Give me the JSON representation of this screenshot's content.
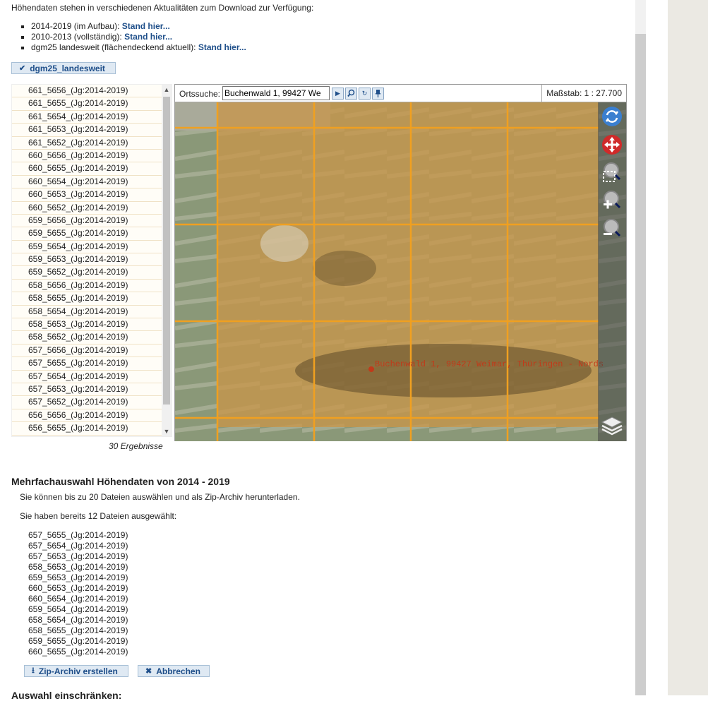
{
  "intro_text": "Höhendaten stehen in verschiedenen Aktualitäten zum Download zur Verfügung:",
  "versions": [
    {
      "text": "2014-2019 (im Aufbau):",
      "link": "Stand hier..."
    },
    {
      "text": "2010-2013 (vollständig):",
      "link": "Stand hier..."
    },
    {
      "text": "dgm25 landesweit (flächendeckend aktuell):",
      "link": "Stand hier..."
    }
  ],
  "dgm_button_label": "dgm25_landesweit",
  "result_items": [
    "661_5656_(Jg:2014-2019)",
    "661_5655_(Jg:2014-2019)",
    "661_5654_(Jg:2014-2019)",
    "661_5653_(Jg:2014-2019)",
    "661_5652_(Jg:2014-2019)",
    "660_5656_(Jg:2014-2019)",
    "660_5655_(Jg:2014-2019)",
    "660_5654_(Jg:2014-2019)",
    "660_5653_(Jg:2014-2019)",
    "660_5652_(Jg:2014-2019)",
    "659_5656_(Jg:2014-2019)",
    "659_5655_(Jg:2014-2019)",
    "659_5654_(Jg:2014-2019)",
    "659_5653_(Jg:2014-2019)",
    "659_5652_(Jg:2014-2019)",
    "658_5656_(Jg:2014-2019)",
    "658_5655_(Jg:2014-2019)",
    "658_5654_(Jg:2014-2019)",
    "658_5653_(Jg:2014-2019)",
    "658_5652_(Jg:2014-2019)",
    "657_5656_(Jg:2014-2019)",
    "657_5655_(Jg:2014-2019)",
    "657_5654_(Jg:2014-2019)",
    "657_5653_(Jg:2014-2019)",
    "657_5652_(Jg:2014-2019)",
    "656_5656_(Jg:2014-2019)",
    "656_5655_(Jg:2014-2019)"
  ],
  "result_count": "30 Ergebnisse",
  "map": {
    "search_label": "Ortssuche:",
    "search_value": "Buchenwald 1, 99427 We",
    "scale_text": "Maßstab: 1 : 27.700",
    "marker_label": "Buchenwald 1, 99427 Weimar, Thüringen - Nords"
  },
  "multi": {
    "heading": "Mehrfachauswahl Höhendaten von 2014 - 2019",
    "info": "Sie können bis zu 20 Dateien auswählen und als Zip-Archiv herunterladen.",
    "selected_info": "Sie haben bereits 12 Dateien ausgewählt:",
    "selected": [
      "657_5655_(Jg:2014-2019)",
      "657_5654_(Jg:2014-2019)",
      "657_5653_(Jg:2014-2019)",
      "658_5653_(Jg:2014-2019)",
      "659_5653_(Jg:2014-2019)",
      "660_5653_(Jg:2014-2019)",
      "660_5654_(Jg:2014-2019)",
      "659_5654_(Jg:2014-2019)",
      "658_5654_(Jg:2014-2019)",
      "658_5655_(Jg:2014-2019)",
      "659_5655_(Jg:2014-2019)",
      "660_5655_(Jg:2014-2019)"
    ],
    "zip_button": "Zip-Archiv erstellen",
    "cancel_button": "Abbrechen"
  },
  "cutoff_heading": "Auswahl einschränken:",
  "colors": {
    "grid": "#f0a020",
    "overlay": "#c8964a",
    "link": "#1f4f8a",
    "marker": "#c03a1a"
  }
}
